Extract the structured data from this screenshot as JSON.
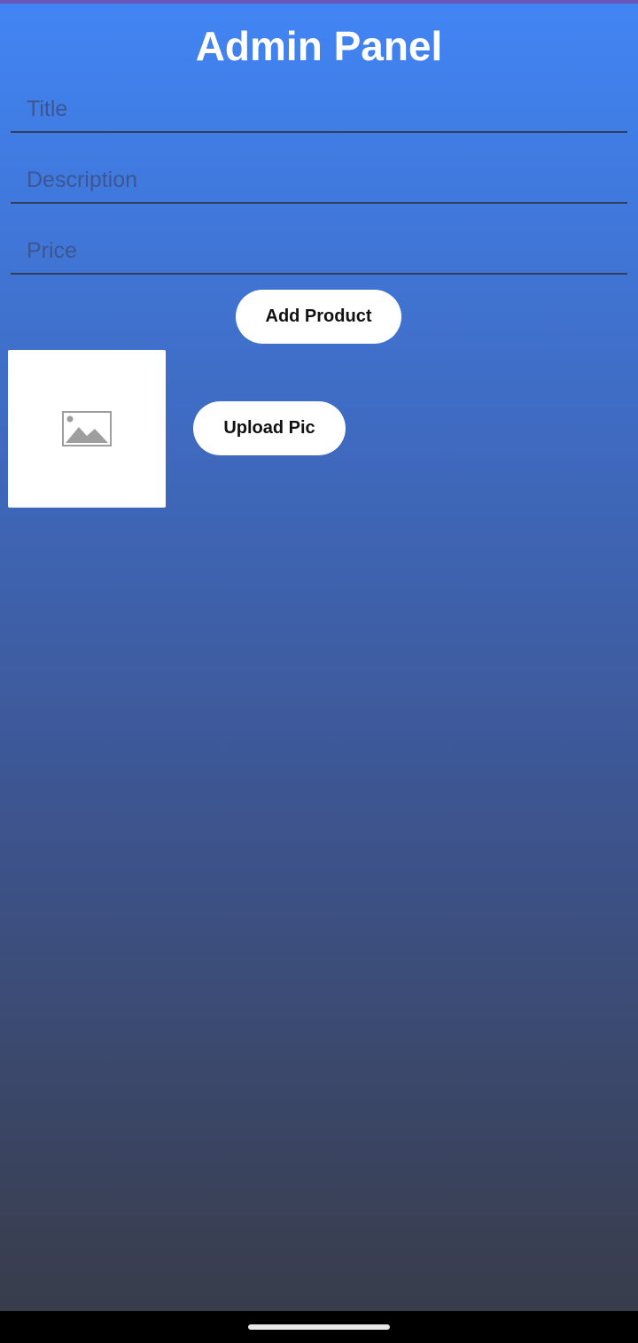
{
  "header": {
    "title": "Admin Panel"
  },
  "form": {
    "title_placeholder": "Title",
    "description_placeholder": "Description",
    "price_placeholder": "Price",
    "title_value": "",
    "description_value": "",
    "price_value": ""
  },
  "actions": {
    "add_product_label": "Add Product",
    "upload_pic_label": "Upload Pic"
  },
  "preview": {
    "icon": "image-placeholder-icon"
  },
  "colors": {
    "gradient_top": "#4185f4",
    "gradient_bottom": "#383c4a",
    "button_bg": "#ffffff",
    "title_text": "#ffffff"
  }
}
